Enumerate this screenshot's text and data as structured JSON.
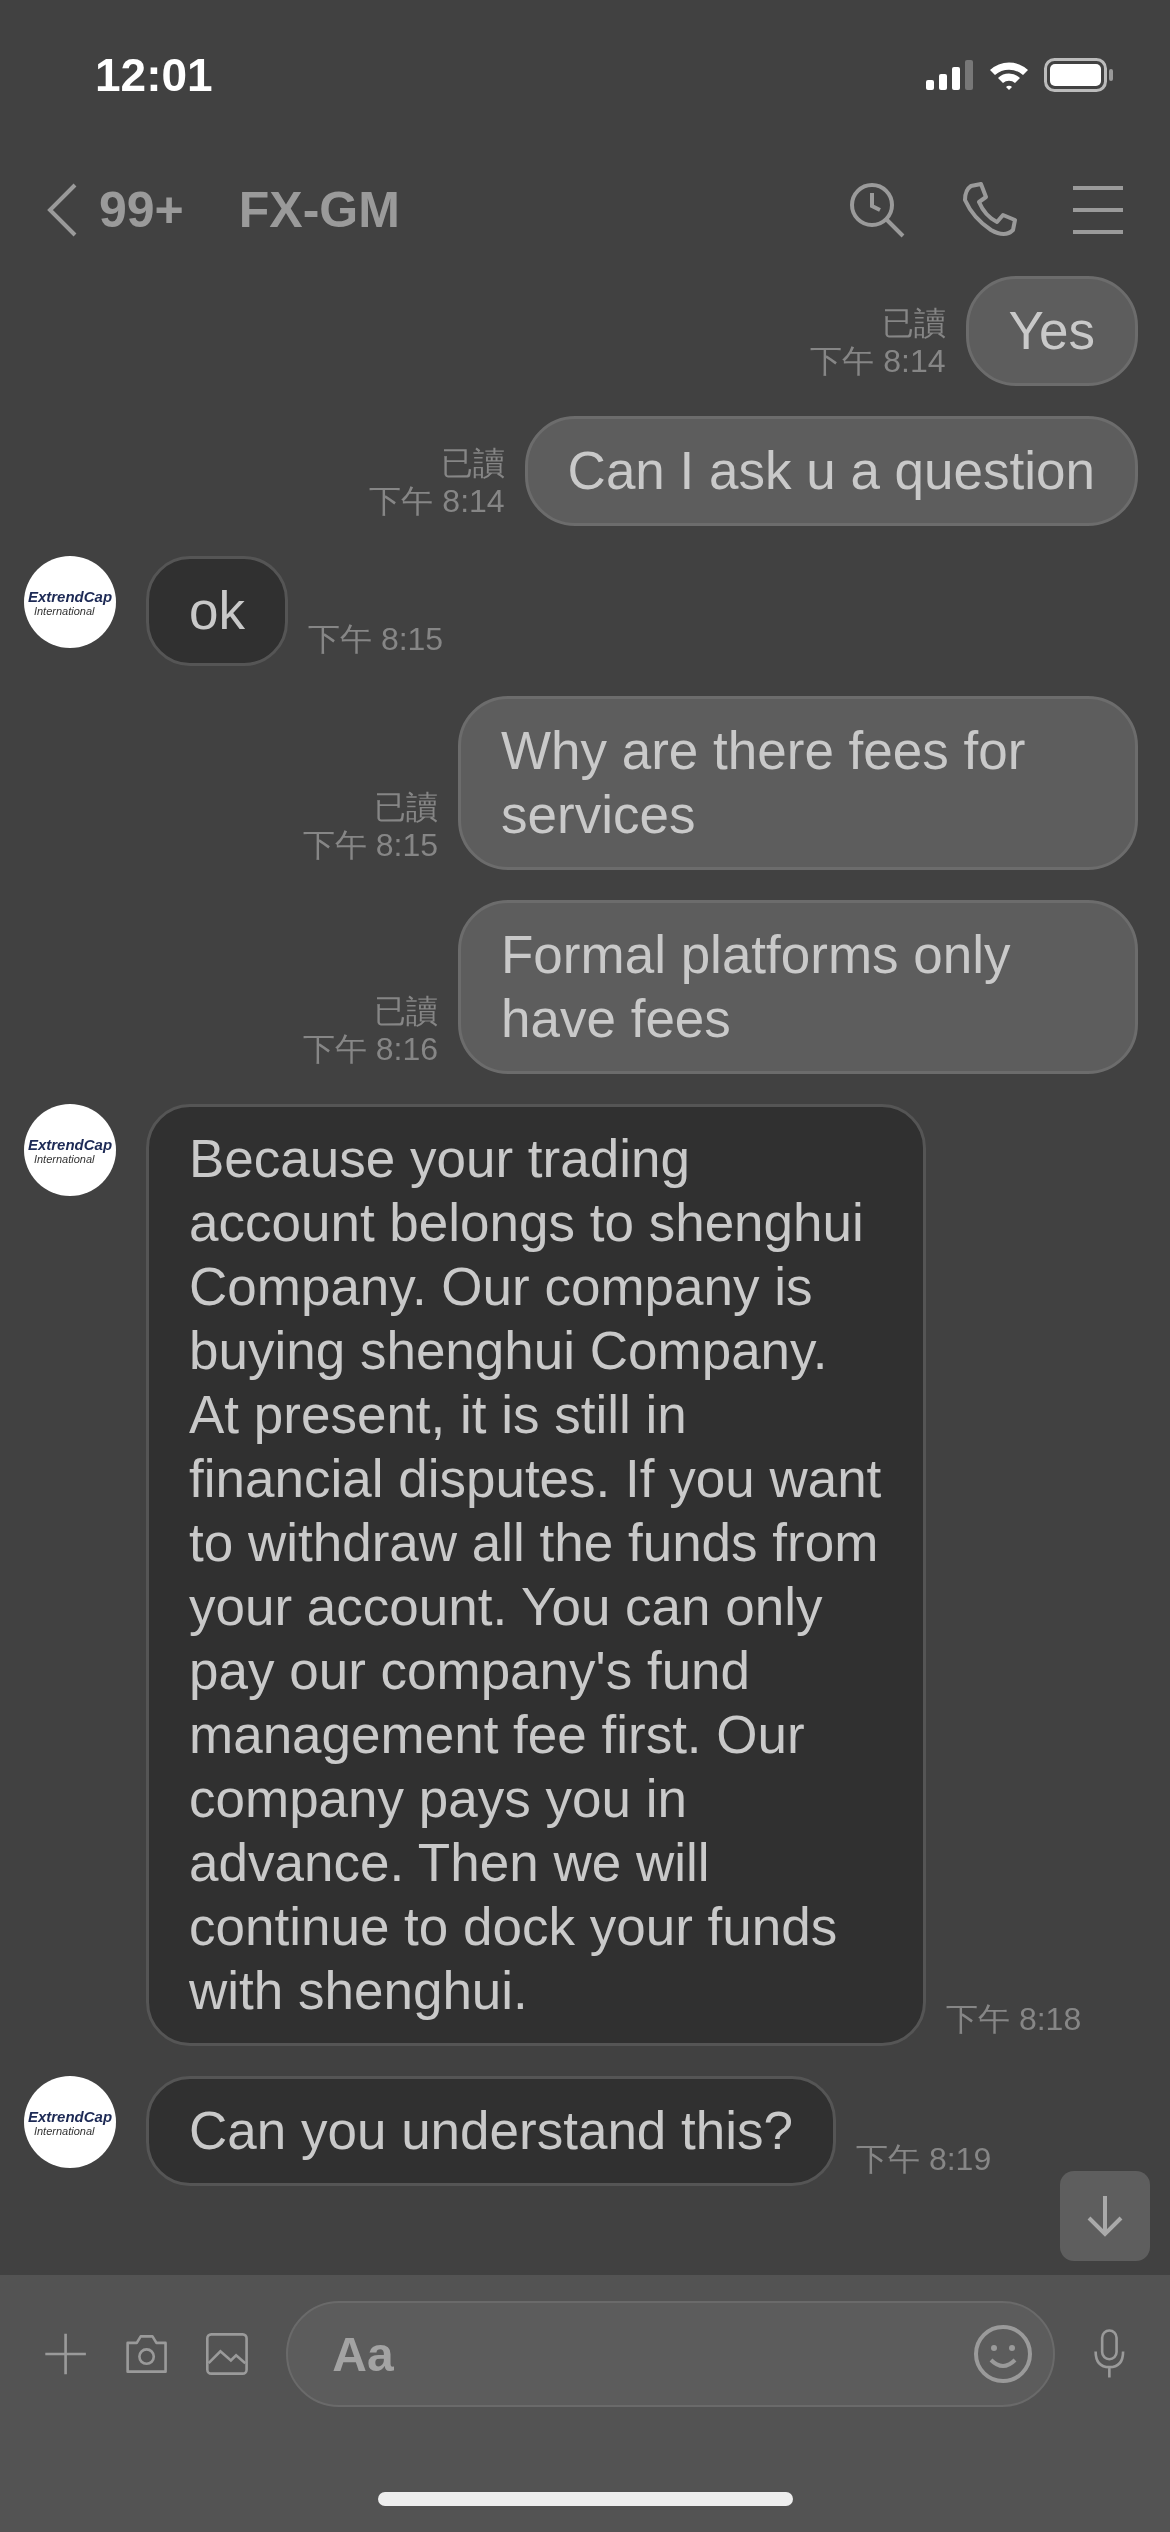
{
  "status_bar": {
    "time": "12:01"
  },
  "header": {
    "back_count": "99+",
    "title": "FX-GM"
  },
  "messages": [
    {
      "kind": "sent",
      "text": "Yes",
      "read_label": "已讀",
      "time": "下午 8:14"
    },
    {
      "kind": "sent",
      "text": "Can I ask u a question",
      "read_label": "已讀",
      "time": "下午 8:14"
    },
    {
      "kind": "received",
      "text": "ok",
      "time": "下午 8:15",
      "avatar": {
        "name": "ExtrendCap",
        "subtitle": "International"
      }
    },
    {
      "kind": "sent",
      "text": "Why are there fees for services",
      "read_label": "已讀",
      "time": "下午 8:15"
    },
    {
      "kind": "sent",
      "text": "Formal platforms only have fees",
      "read_label": "已讀",
      "time": "下午 8:16"
    },
    {
      "kind": "received",
      "text": "Because your trading account belongs to shenghui Company. Our company is buying shenghui Company. At present, it is still in financial disputes. If you want to withdraw all the funds from your account. You can only pay our company's fund management fee first. Our company pays you in advance. Then we will continue to dock your funds with shenghui.",
      "time": "下午 8:18",
      "avatar": {
        "name": "ExtrendCap",
        "subtitle": "International"
      }
    },
    {
      "kind": "received",
      "text": "Can you understand this?",
      "time": "下午 8:19",
      "avatar": {
        "name": "ExtrendCap",
        "subtitle": "International"
      }
    }
  ],
  "composer": {
    "placeholder": "Aa"
  }
}
